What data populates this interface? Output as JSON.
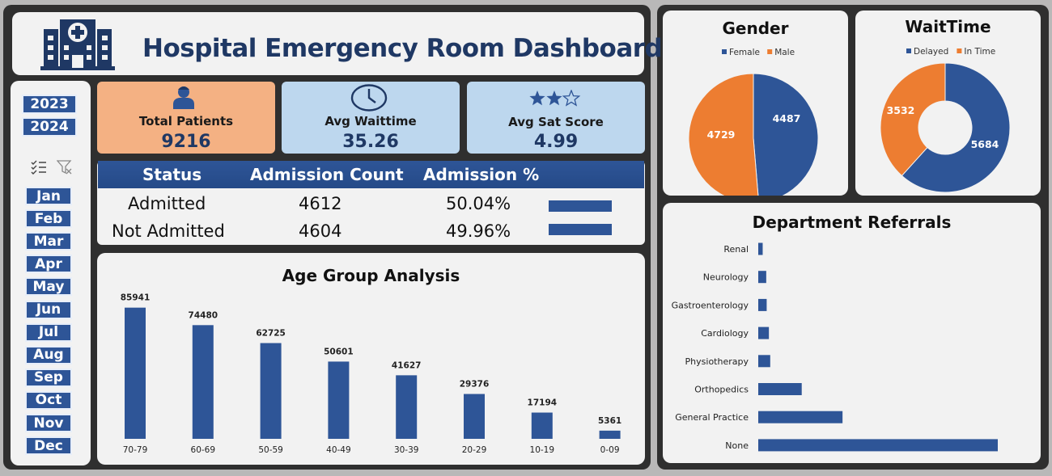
{
  "header": {
    "title": "Hospital Emergency Room Dashboard"
  },
  "years": [
    "2023",
    "2024"
  ],
  "months": [
    "Jan",
    "Feb",
    "Mar",
    "Apr",
    "May",
    "Jun",
    "Jul",
    "Aug",
    "Sep",
    "Oct",
    "Nov",
    "Dec"
  ],
  "kpis": {
    "total_patients": {
      "label": "Total Patients",
      "value": "9216"
    },
    "avg_waittime": {
      "label": "Avg Waittime",
      "value": "35.26"
    },
    "avg_sat": {
      "label": "Avg Sat Score",
      "value": "4.99"
    }
  },
  "admission_table": {
    "headers": [
      "Status",
      "Admission Count",
      "Admission %"
    ],
    "rows": [
      {
        "status": "Admitted",
        "count": "4612",
        "pct": "50.04%"
      },
      {
        "status": "Not Admitted",
        "count": "4604",
        "pct": "49.96%"
      }
    ],
    "bar_fraction": [
      0.5004,
      0.4996
    ]
  },
  "colors": {
    "blue": "#2e5597",
    "orange": "#ed7d31",
    "navy": "#1f3864",
    "kpi_orange": "#f4b183",
    "kpi_blue": "#bdd7ee"
  },
  "chart_data": [
    {
      "type": "bar",
      "title": "Age Group Analysis",
      "categories": [
        "70-79",
        "60-69",
        "50-59",
        "40-49",
        "30-39",
        "20-29",
        "10-19",
        "0-09"
      ],
      "values": [
        85941,
        74480,
        62725,
        50601,
        41627,
        29376,
        17194,
        5361
      ],
      "ylim": [
        0,
        90000
      ],
      "grid": false,
      "color": "#2e5597"
    },
    {
      "type": "pie",
      "title": "Gender",
      "categories": [
        "Female",
        "Male"
      ],
      "values": [
        4487,
        4729
      ],
      "colors": [
        "#2e5597",
        "#ed7d31"
      ],
      "legend": "top"
    },
    {
      "type": "pie",
      "title": "WaitTime",
      "categories": [
        "Delayed",
        "In Time"
      ],
      "values": [
        5684,
        3532
      ],
      "colors": [
        "#2e5597",
        "#ed7d31"
      ],
      "donut": true,
      "legend": "top"
    },
    {
      "type": "bar",
      "orientation": "horizontal",
      "title": "Department Referrals",
      "categories": [
        "Renal",
        "Neurology",
        "Gastroenterology",
        "Cardiology",
        "Physiotherapy",
        "Orthopedics",
        "General Practice",
        "None"
      ],
      "values": [
        50,
        90,
        95,
        120,
        135,
        490,
        950,
        2700
      ],
      "grid": false,
      "color": "#2e5597"
    }
  ]
}
